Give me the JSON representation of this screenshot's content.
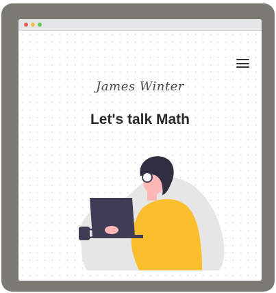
{
  "window": {
    "controls": [
      "close",
      "minimize",
      "maximize"
    ]
  },
  "nav": {
    "menu_icon": "hamburger-menu-icon"
  },
  "hero": {
    "author": "James Winter",
    "headline": "Let's talk Math"
  },
  "illustration": {
    "subject": "person-working-on-laptop",
    "colors": {
      "shirt": "#fbbe2e",
      "hair": "#2f2e41",
      "skin": "#ffb6b6",
      "laptop": "#3f3d56",
      "blob": "#e6e6e6"
    }
  },
  "colors": {
    "frame": "#7b7a74",
    "titlebar": "#e4e6e8",
    "text": "#2a2a2a"
  }
}
